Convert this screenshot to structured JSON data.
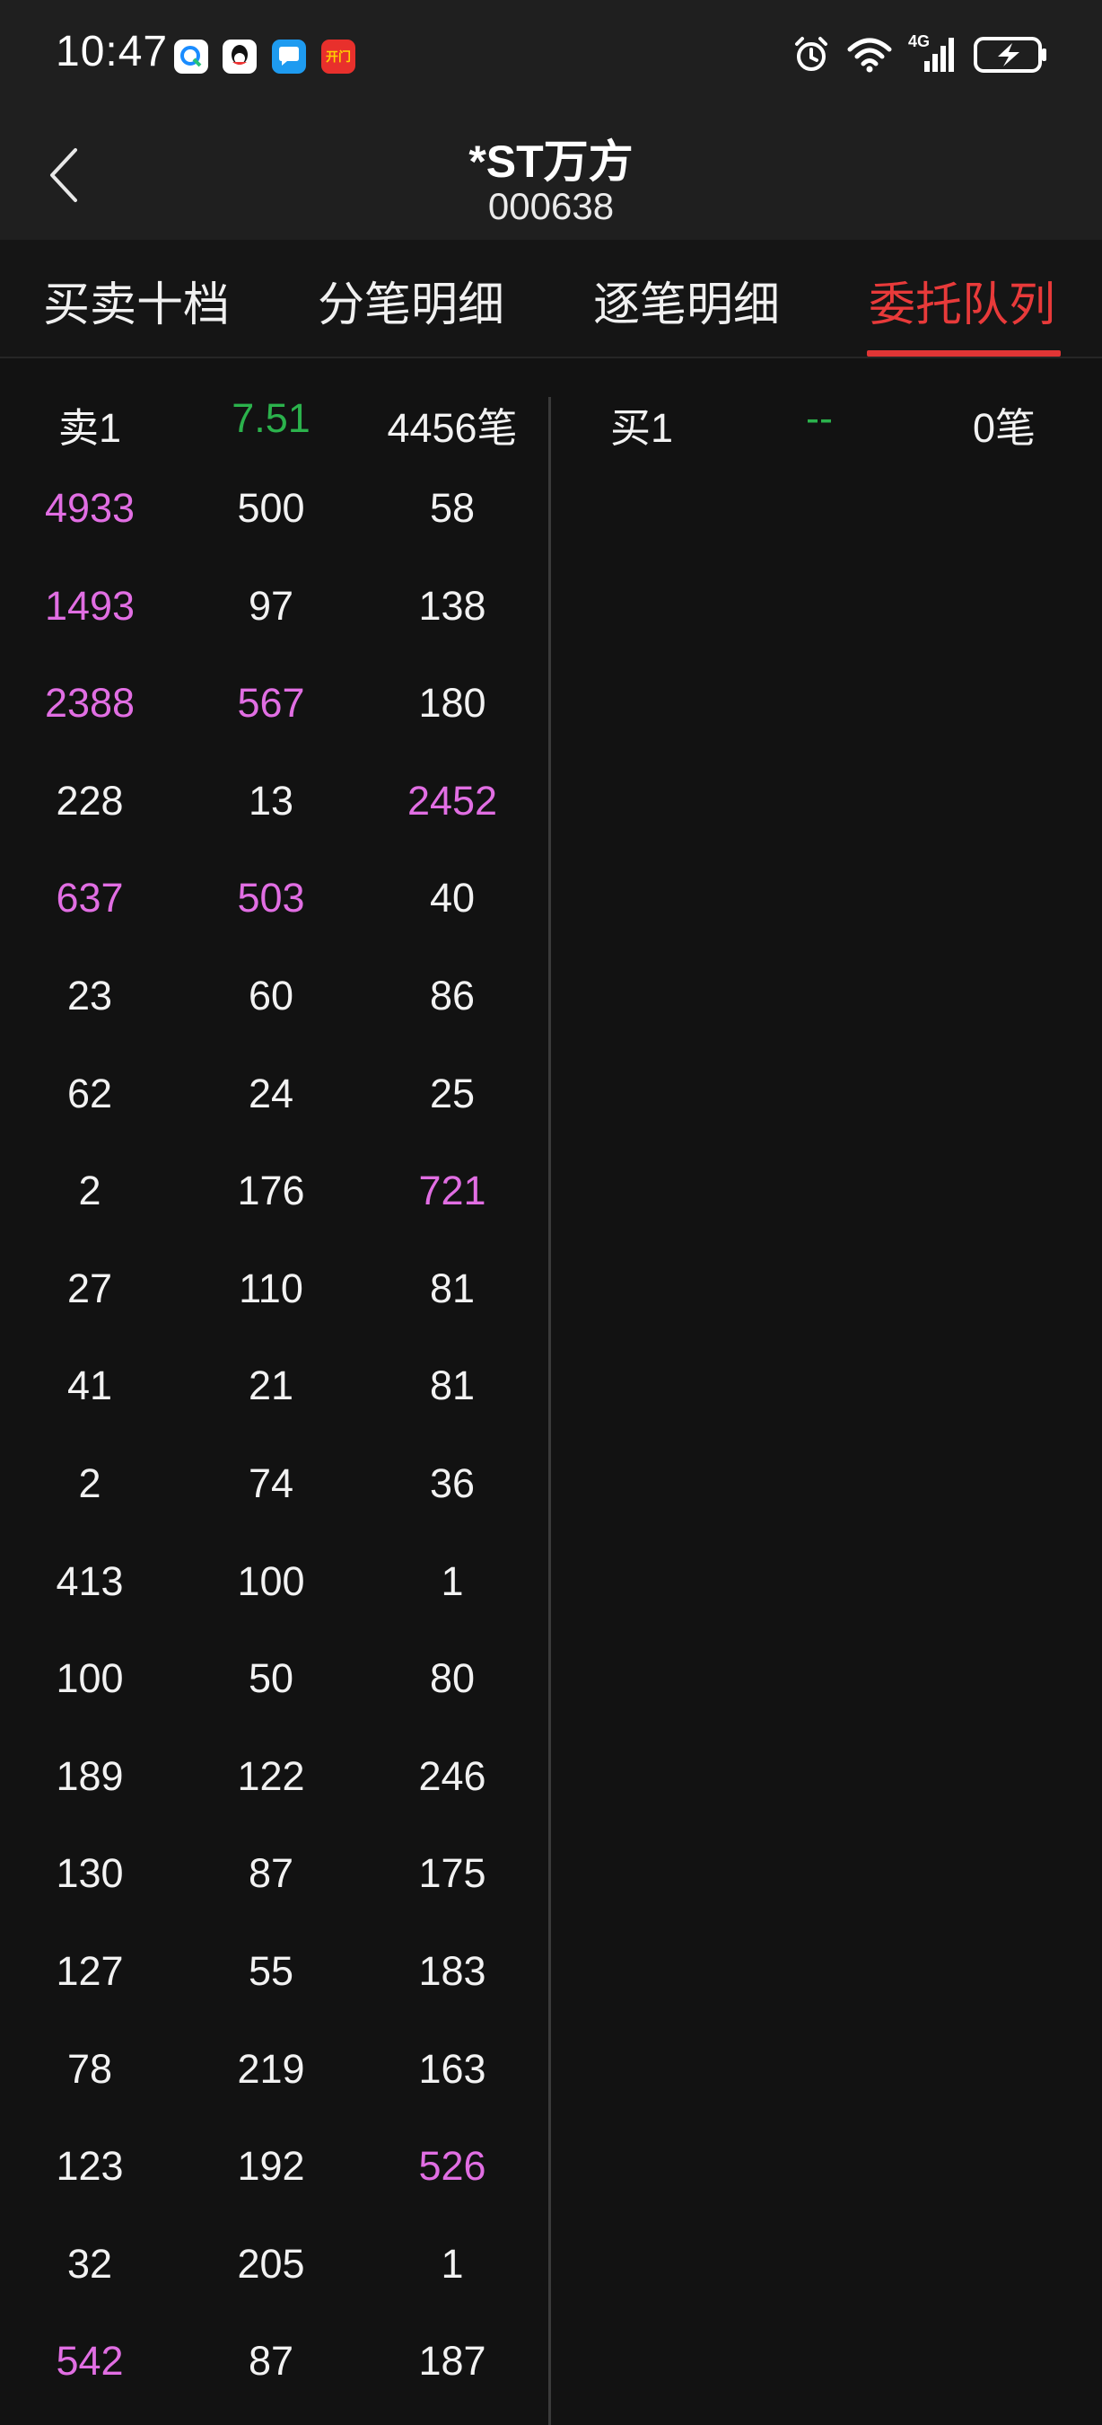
{
  "status_bar": {
    "time": "10:47",
    "app_icons": [
      "maps-app-icon",
      "qq-app-icon",
      "message-app-icon",
      "news-app-icon"
    ],
    "news_icon_text": "开门",
    "network": "4G",
    "icons": [
      "alarm-icon",
      "wifi-icon",
      "signal-icon",
      "battery-charging-icon"
    ]
  },
  "header": {
    "title": "*ST万方",
    "code": "000638"
  },
  "tabs": [
    {
      "label": "买卖十档"
    },
    {
      "label": "分笔明细"
    },
    {
      "label": "逐笔明细"
    },
    {
      "label": "委托队列",
      "active": true
    }
  ],
  "sell_queue": {
    "label": "卖1",
    "price": "7.51",
    "count": "4456笔",
    "rows": [
      [
        {
          "v": "4933",
          "hl": true
        },
        {
          "v": "500",
          "hl": false
        },
        {
          "v": "58",
          "hl": false
        }
      ],
      [
        {
          "v": "1493",
          "hl": true
        },
        {
          "v": "97",
          "hl": false
        },
        {
          "v": "138",
          "hl": false
        }
      ],
      [
        {
          "v": "2388",
          "hl": true
        },
        {
          "v": "567",
          "hl": true
        },
        {
          "v": "180",
          "hl": false
        }
      ],
      [
        {
          "v": "228",
          "hl": false
        },
        {
          "v": "13",
          "hl": false
        },
        {
          "v": "2452",
          "hl": true
        }
      ],
      [
        {
          "v": "637",
          "hl": true
        },
        {
          "v": "503",
          "hl": true
        },
        {
          "v": "40",
          "hl": false
        }
      ],
      [
        {
          "v": "23",
          "hl": false
        },
        {
          "v": "60",
          "hl": false
        },
        {
          "v": "86",
          "hl": false
        }
      ],
      [
        {
          "v": "62",
          "hl": false
        },
        {
          "v": "24",
          "hl": false
        },
        {
          "v": "25",
          "hl": false
        }
      ],
      [
        {
          "v": "2",
          "hl": false
        },
        {
          "v": "176",
          "hl": false
        },
        {
          "v": "721",
          "hl": true
        }
      ],
      [
        {
          "v": "27",
          "hl": false
        },
        {
          "v": "110",
          "hl": false
        },
        {
          "v": "81",
          "hl": false
        }
      ],
      [
        {
          "v": "41",
          "hl": false
        },
        {
          "v": "21",
          "hl": false
        },
        {
          "v": "81",
          "hl": false
        }
      ],
      [
        {
          "v": "2",
          "hl": false
        },
        {
          "v": "74",
          "hl": false
        },
        {
          "v": "36",
          "hl": false
        }
      ],
      [
        {
          "v": "413",
          "hl": false
        },
        {
          "v": "100",
          "hl": false
        },
        {
          "v": "1",
          "hl": false
        }
      ],
      [
        {
          "v": "100",
          "hl": false
        },
        {
          "v": "50",
          "hl": false
        },
        {
          "v": "80",
          "hl": false
        }
      ],
      [
        {
          "v": "189",
          "hl": false
        },
        {
          "v": "122",
          "hl": false
        },
        {
          "v": "246",
          "hl": false
        }
      ],
      [
        {
          "v": "130",
          "hl": false
        },
        {
          "v": "87",
          "hl": false
        },
        {
          "v": "175",
          "hl": false
        }
      ],
      [
        {
          "v": "127",
          "hl": false
        },
        {
          "v": "55",
          "hl": false
        },
        {
          "v": "183",
          "hl": false
        }
      ],
      [
        {
          "v": "78",
          "hl": false
        },
        {
          "v": "219",
          "hl": false
        },
        {
          "v": "163",
          "hl": false
        }
      ],
      [
        {
          "v": "123",
          "hl": false
        },
        {
          "v": "192",
          "hl": false
        },
        {
          "v": "526",
          "hl": true
        }
      ],
      [
        {
          "v": "32",
          "hl": false
        },
        {
          "v": "205",
          "hl": false
        },
        {
          "v": "1",
          "hl": false
        }
      ],
      [
        {
          "v": "542",
          "hl": true
        },
        {
          "v": "87",
          "hl": false
        },
        {
          "v": "187",
          "hl": false
        }
      ]
    ]
  },
  "buy_queue": {
    "label": "买1",
    "price": "--",
    "count": "0笔"
  },
  "colors": {
    "highlight": "#e16ee3",
    "price_green": "#2bb24c",
    "active_tab": "#e83a3a"
  }
}
